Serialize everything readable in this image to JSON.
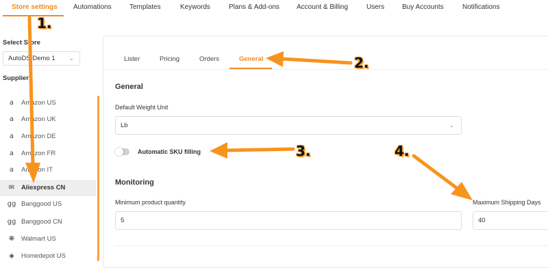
{
  "top_nav": {
    "tabs": [
      {
        "label": "Store settings",
        "active": true
      },
      {
        "label": "Automations"
      },
      {
        "label": "Templates"
      },
      {
        "label": "Keywords"
      },
      {
        "label": "Plans & Add-ons"
      },
      {
        "label": "Account & Billing"
      },
      {
        "label": "Users"
      },
      {
        "label": "Buy Accounts"
      },
      {
        "label": "Notifications"
      }
    ]
  },
  "sidebar": {
    "select_store_label": "Select Store",
    "store_value": "AutoDS Demo 1",
    "supplier_label": "Supplier",
    "suppliers": [
      {
        "label": "Amazon US",
        "icon": "amazon-icon"
      },
      {
        "label": "Amazon UK",
        "icon": "amazon-icon"
      },
      {
        "label": "Amazon DE",
        "icon": "amazon-icon"
      },
      {
        "label": "Amazon FR",
        "icon": "amazon-icon"
      },
      {
        "label": "Amazon IT",
        "icon": "amazon-icon"
      },
      {
        "label": "Aliexpress CN",
        "icon": "aliexpress-icon",
        "active": true
      },
      {
        "label": "Banggood US",
        "icon": "banggood-icon"
      },
      {
        "label": "Banggood CN",
        "icon": "banggood-icon"
      },
      {
        "label": "Walmart US",
        "icon": "walmart-icon"
      },
      {
        "label": "Homedepot US",
        "icon": "homedepot-icon"
      }
    ]
  },
  "panel": {
    "tabs": [
      {
        "label": "Lister"
      },
      {
        "label": "Pricing"
      },
      {
        "label": "Orders"
      },
      {
        "label": "General",
        "active": true
      }
    ],
    "general_heading": "General",
    "weight_unit_label": "Default Weight Unit",
    "weight_unit_value": "Lb",
    "sku_toggle_label": "Automatic SKU filling",
    "sku_toggle_on": false,
    "monitoring_heading": "Monitoring",
    "min_qty_label": "Minimum product quantity",
    "min_qty_value": "5",
    "max_ship_label": "Maximum Shipping Days",
    "max_ship_value": "40"
  },
  "annotations": {
    "step1": "1.",
    "step2": "2.",
    "step3": "3.",
    "step4": "4.",
    "arrow_color": "#f7941d"
  },
  "colors": {
    "accent": "#f08a24"
  }
}
